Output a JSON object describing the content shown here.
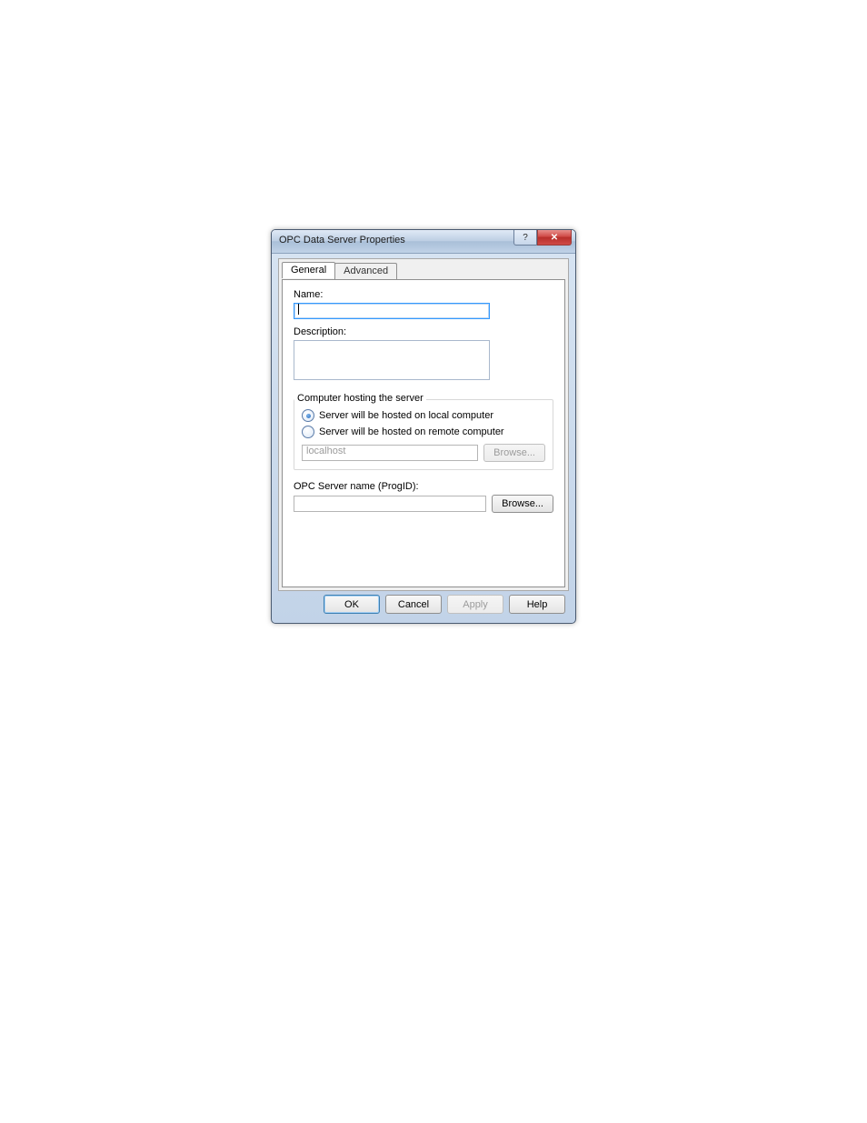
{
  "dialog": {
    "title": "OPC Data Server Properties",
    "tabs": [
      {
        "label": "General",
        "active": true
      },
      {
        "label": "Advanced",
        "active": false
      }
    ],
    "fields": {
      "name_label": "Name:",
      "name_value": "",
      "description_label": "Description:",
      "description_value": ""
    },
    "hosting_group": {
      "title": "Computer hosting the server",
      "options": [
        {
          "label": "Server will be hosted on local computer",
          "selected": true
        },
        {
          "label": "Server will be hosted on remote computer",
          "selected": false
        }
      ],
      "host_value": "localhost",
      "host_input_disabled": true,
      "browse_label": "Browse...",
      "browse_disabled": true
    },
    "progid": {
      "label": "OPC Server name (ProgID):",
      "value": "",
      "browse_label": "Browse..."
    },
    "buttons": {
      "ok": "OK",
      "cancel": "Cancel",
      "apply": "Apply",
      "apply_disabled": true,
      "help": "Help"
    },
    "titlebar_buttons": {
      "help_glyph": "?",
      "close_glyph": "✕"
    }
  }
}
